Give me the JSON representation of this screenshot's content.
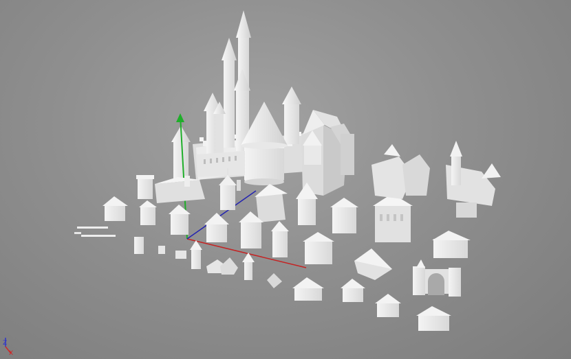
{
  "viewport": {
    "background": "#8f8f8f",
    "model_color": "#ececec",
    "shadow_color": "#bdbdbd"
  },
  "axes": {
    "y_axis_color": "#1fae2a",
    "x_axis_color": "#c42323",
    "z_axis_color": "#2323b0"
  },
  "view_gizmo": {
    "z_label": "Z",
    "x_label": "X",
    "z_color": "#2f35c9",
    "x_color": "#d02626"
  }
}
